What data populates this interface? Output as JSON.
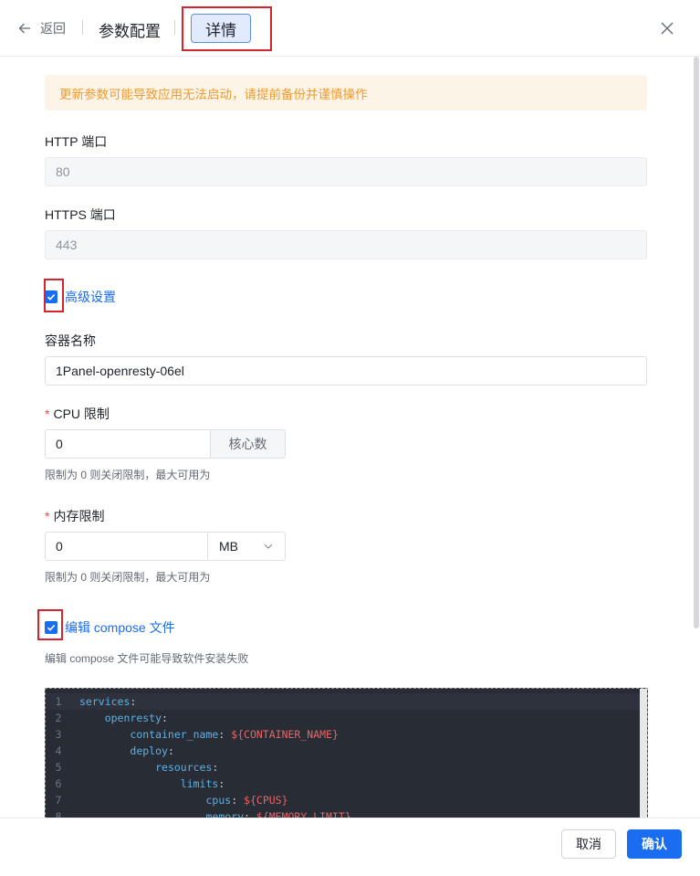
{
  "header": {
    "back_label": "返回",
    "title": "参数配置",
    "tab_label": "详情"
  },
  "alert": {
    "text": "更新参数可能导致应用无法启动，请提前备份并谨慎操作"
  },
  "http_port": {
    "label": "HTTP 端口",
    "value": "80"
  },
  "https_port": {
    "label": "HTTPS 端口",
    "value": "443"
  },
  "advanced": {
    "label": "高级设置",
    "checked": true
  },
  "container_name": {
    "label": "容器名称",
    "value": "1Panel-openresty-06el"
  },
  "cpu_limit": {
    "required_mark": "*",
    "label": "CPU 限制",
    "value": "0",
    "suffix": "核心数",
    "hint": "限制为 0 则关闭限制，最大可用为"
  },
  "memory_limit": {
    "required_mark": "*",
    "label": "内存限制",
    "value": "0",
    "unit": "MB",
    "hint": "限制为 0 则关闭限制，最大可用为"
  },
  "edit_compose": {
    "label": "编辑 compose 文件",
    "checked": true,
    "hint": "编辑 compose 文件可能导致软件安装失败"
  },
  "editor": {
    "lines": [
      {
        "n": "1",
        "indent": "",
        "key": "services",
        "val": ""
      },
      {
        "n": "2",
        "indent": "    ",
        "key": "openresty",
        "val": ""
      },
      {
        "n": "3",
        "indent": "        ",
        "key": "container_name",
        "val": "${CONTAINER_NAME}"
      },
      {
        "n": "4",
        "indent": "        ",
        "key": "deploy",
        "val": ""
      },
      {
        "n": "5",
        "indent": "            ",
        "key": "resources",
        "val": ""
      },
      {
        "n": "6",
        "indent": "                ",
        "key": "limits",
        "val": ""
      },
      {
        "n": "7",
        "indent": "                    ",
        "key": "cpus",
        "val": "${CPUS}"
      },
      {
        "n": "8",
        "indent": "                    ",
        "key": "memory",
        "val": "${MEMORY_LIMIT}"
      }
    ]
  },
  "footer": {
    "cancel_label": "取消",
    "confirm_label": "确认"
  },
  "colors": {
    "primary": "#1a6cf0",
    "warning_text": "#f09a2c",
    "highlight_box": "#d7232b"
  }
}
